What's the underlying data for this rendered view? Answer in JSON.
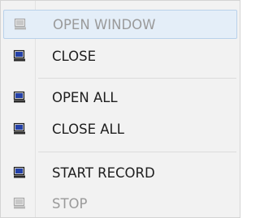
{
  "menu": {
    "items": [
      {
        "label": "OPEN WINDOW",
        "icon": "monitor-icon",
        "enabled": false,
        "highlighted": true
      },
      {
        "label": "CLOSE",
        "icon": "monitor-icon",
        "enabled": true,
        "highlighted": false
      },
      {
        "label": "OPEN ALL",
        "icon": "monitor-icon",
        "enabled": true,
        "highlighted": false
      },
      {
        "label": "CLOSE ALL",
        "icon": "monitor-icon",
        "enabled": true,
        "highlighted": false
      },
      {
        "label": "START RECORD",
        "icon": "monitor-icon",
        "enabled": true,
        "highlighted": false
      },
      {
        "label": "STOP",
        "icon": "monitor-icon",
        "enabled": false,
        "highlighted": false
      }
    ]
  },
  "colors": {
    "menu_background": "#f2f2f2",
    "highlight_background": "#e4eef8",
    "highlight_border": "#b9d1ea",
    "text_enabled": "#1e1e1e",
    "text_disabled": "#9a9a9a",
    "icon_frame_enabled": "#1c1c1c",
    "icon_screen_enabled": "#2340a8",
    "icon_frame_disabled": "#a8a8a8",
    "icon_screen_disabled": "#c8c8c8"
  }
}
